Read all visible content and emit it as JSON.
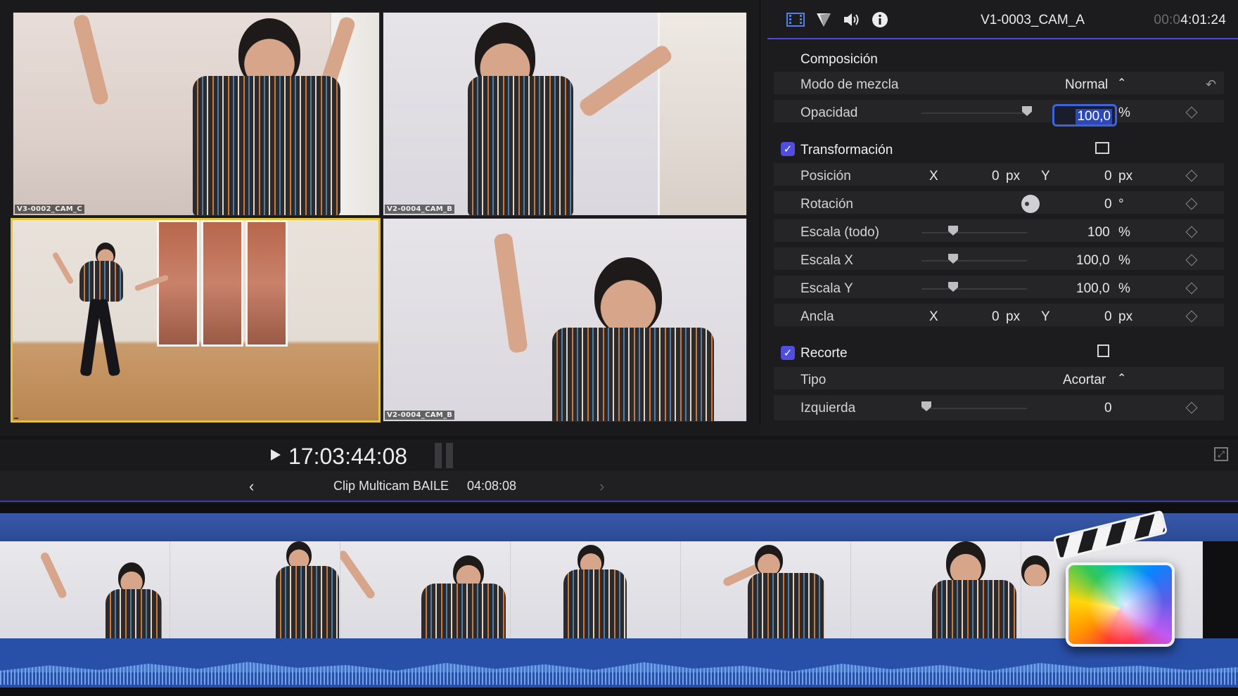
{
  "viewer": {
    "angles": [
      {
        "label": "V3-0002_CAM_C"
      },
      {
        "label": "V2-0004_CAM_B"
      },
      {
        "label": ""
      },
      {
        "label": "V2-0004_CAM_B"
      }
    ]
  },
  "inspector": {
    "tabs": [
      "video-icon",
      "color-icon",
      "audio-icon",
      "info-icon"
    ],
    "clip_name": "V1-0003_CAM_A",
    "timecode_dim": "00:0",
    "timecode": "4:01:24",
    "sections": {
      "composition": {
        "title": "Composición",
        "blend_mode_label": "Modo de mezcla",
        "blend_mode_value": "Normal",
        "opacity_label": "Opacidad",
        "opacity_value": "100,0",
        "opacity_unit": "%",
        "opacity_level": 1.0
      },
      "transform": {
        "title": "Transformación",
        "enabled": true,
        "position_label": "Posición",
        "position_x": "0",
        "position_y": "0",
        "px_unit": "px",
        "x_axis": "X",
        "y_axis": "Y",
        "rotation_label": "Rotación",
        "rotation_value": "0",
        "rotation_unit": "°",
        "scale_all_label": "Escala (todo)",
        "scale_all_value": "100",
        "scale_x_label": "Escala X",
        "scale_x_value": "100,0",
        "scale_y_label": "Escala Y",
        "scale_y_value": "100,0",
        "percent_unit": "%",
        "anchor_label": "Ancla",
        "anchor_x": "0",
        "anchor_y": "0"
      },
      "crop": {
        "title": "Recorte",
        "enabled": true,
        "type_label": "Tipo",
        "type_value": "Acortar",
        "left_label": "Izquierda",
        "left_value": "0"
      }
    }
  },
  "transport": {
    "timecode": "17:03:44:08"
  },
  "navbar": {
    "back": "‹",
    "forward": "›",
    "clip_name": "Clip Multicam BAILE",
    "duration": "04:08:08"
  },
  "colors": {
    "accent": "#4b4ad8",
    "active_angle": "#e2c33c",
    "timeline_video": "#2a4a98"
  }
}
